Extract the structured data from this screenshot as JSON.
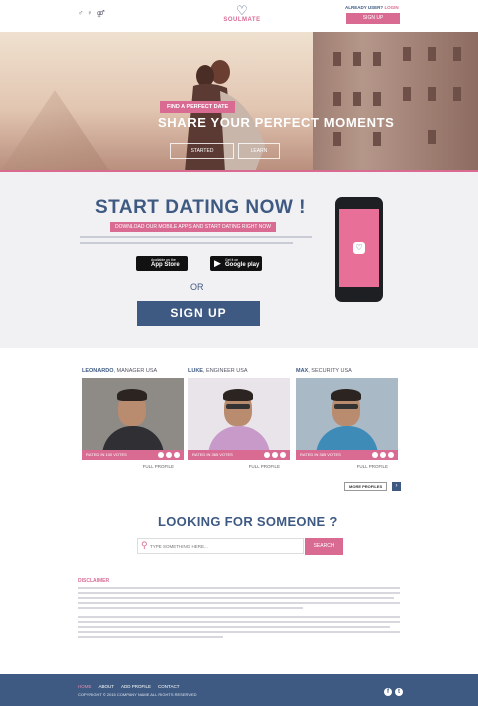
{
  "header": {
    "top_icons": [
      "♂",
      "♀",
      "⚤"
    ],
    "logo_text": "SOULMATE",
    "already_user": "ALREADY USER?",
    "login_label": "LOGIN",
    "signup_label": "SIGN UP"
  },
  "hero": {
    "tag": "FIND A PERFECT DATE",
    "title": "SHARE YOUR PERFECT MOMENTS",
    "btn1": "STARTED",
    "btn2": "LEARN"
  },
  "dating": {
    "title": "START DATING NOW !",
    "subtitle": "DOWNLOAD OUR MOBILE APPS AND START DATING RIGHT NOW",
    "appstore_small": "Available on the",
    "appstore_big": "App Store",
    "googleplay_small": "Get it on",
    "googleplay_big": "Google play",
    "or": "OR",
    "signup_label": "SIGN UP"
  },
  "profiles": [
    {
      "name": "LEONARDO",
      "role": ", MANAGER USA",
      "voted": "RATED IN 100 VOTES",
      "full": "FULL PROFILE",
      "shirt": "#2f2f34"
    },
    {
      "name": "LUKE",
      "role": ", ENGINEER USA",
      "voted": "RATED IN 365 VOTES",
      "full": "FULL PROFILE",
      "shirt": "#c89ac9"
    },
    {
      "name": "MAX",
      "role": ", SECURITY USA",
      "voted": "RATED IN 365 VOTES",
      "full": "FULL PROFILE",
      "shirt": "#3e8bb8"
    }
  ],
  "more_profiles": "MORE PROFILES",
  "search": {
    "title": "LOOKING FOR SOMEONE ?",
    "placeholder": "TYPE SOMETHING HERE...",
    "button": "SEARCH"
  },
  "disclaimer_title": "DISCLAIMER",
  "footer": {
    "nav": [
      "HOME",
      "ABOUT",
      "ADD PROFILE",
      "CONTACT"
    ],
    "copyright": "COPYRIGHT © 2015 COMPANY NAME ALL RIGHTS RESERVED",
    "social": [
      "f",
      "t"
    ]
  },
  "colors": {
    "accent": "#d96b93",
    "primary": "#3e5a82"
  }
}
